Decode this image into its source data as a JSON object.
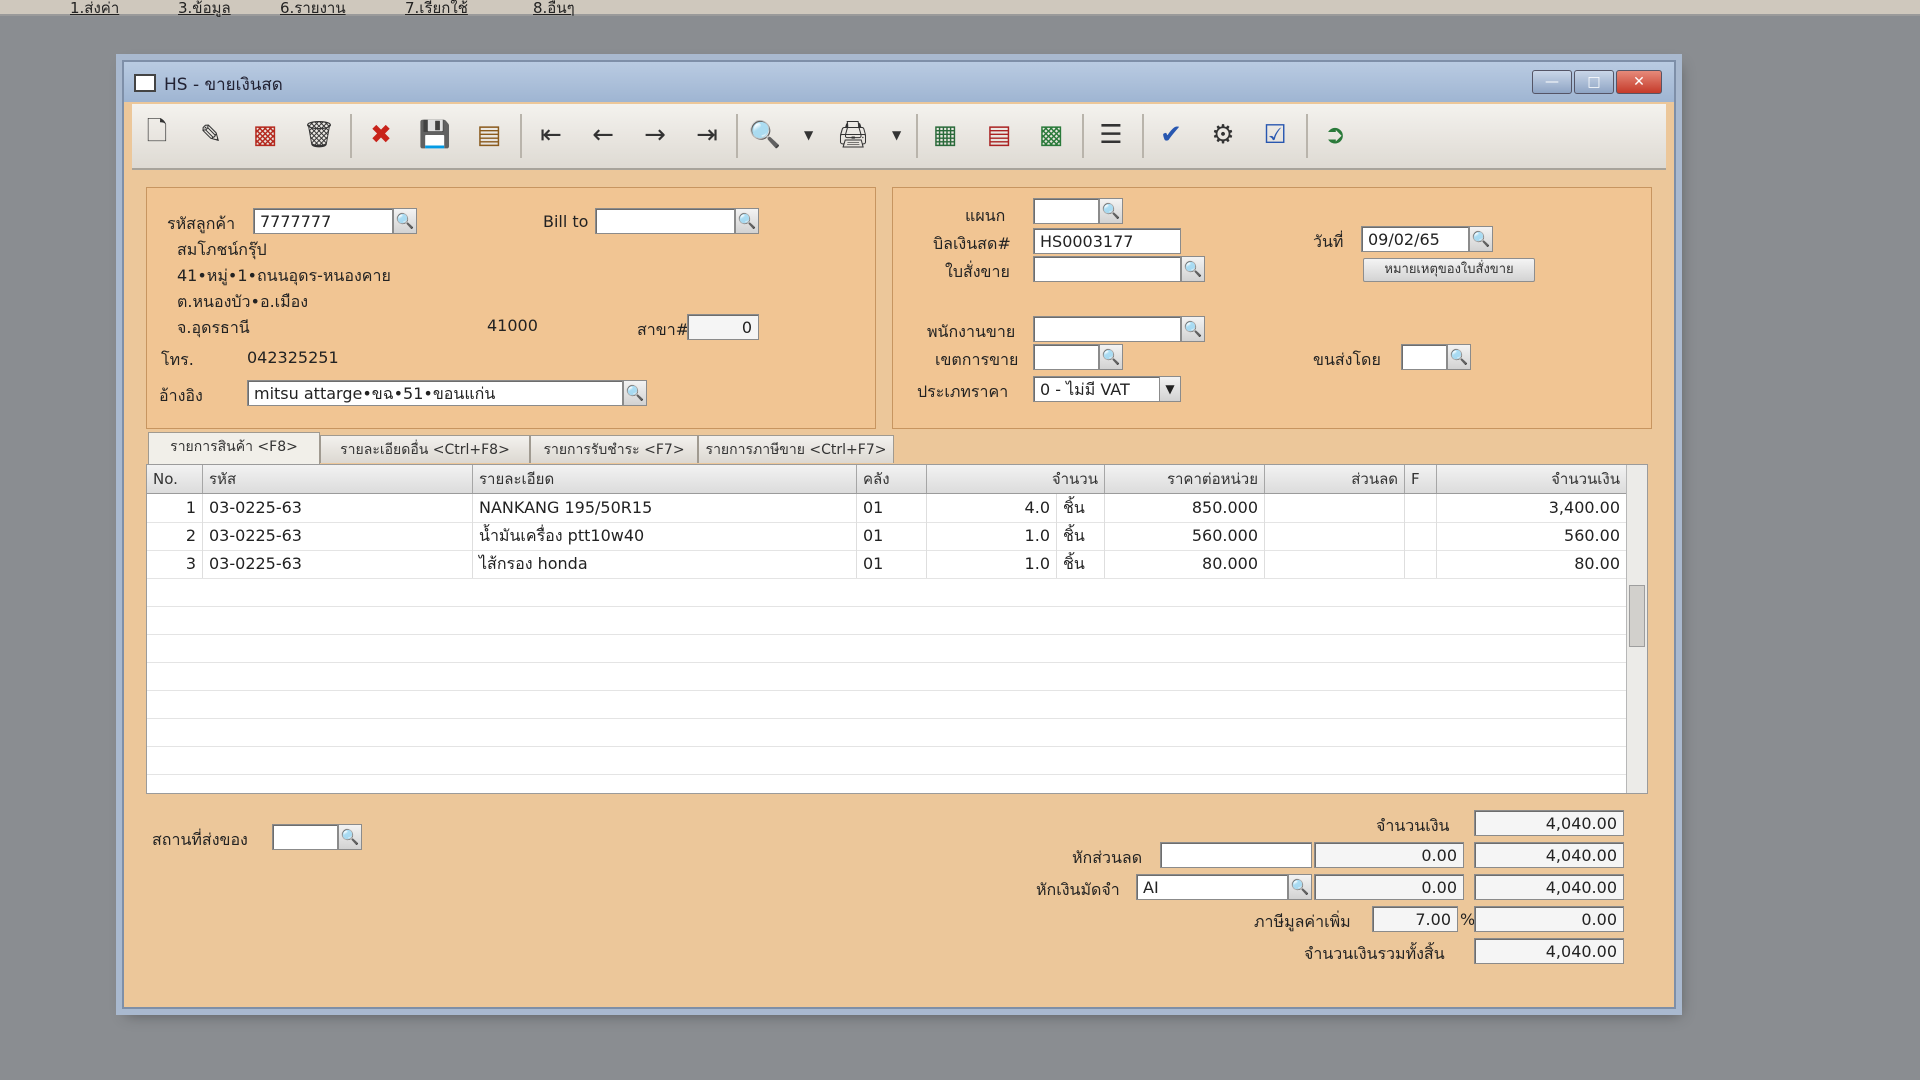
{
  "menubar": [
    "1.ส่งค่า",
    "3.ข้อมูล",
    "6.รายงาน",
    "7.เรียกใช้",
    "8.อื่นๆ"
  ],
  "window": {
    "title": "HS - ขายเงินสด"
  },
  "toolbar": {
    "icons": [
      "new-icon",
      "edit-icon",
      "void-icon",
      "delete-icon",
      "cancel-icon",
      "save-icon",
      "copy-icon",
      "first-icon",
      "prev-icon",
      "next-icon",
      "last-icon",
      "preview-icon",
      "print-icon",
      "calc-icon",
      "form-icon",
      "report-icon",
      "list-icon",
      "approve-icon",
      "check-icon",
      "ok-icon",
      "exit-icon"
    ]
  },
  "customer": {
    "code_label": "รหัสลูกค้า",
    "code": "7777777",
    "billto_label": "Bill to",
    "billto": "",
    "name": "สมโภชน์กรุ๊ป",
    "addr1": "41•หมู่•1•ถนนอุดร-หนองคาย",
    "addr2": "ต.หนองบัว•อ.เมือง",
    "addr3": "จ.อุดรธานี",
    "zip": "41000",
    "branch_label": "สาขา#",
    "branch": "0",
    "tel_label": "โทร.",
    "tel": "042325251",
    "ref_label": "อ้างอิง",
    "ref": "mitsu attarge•ขฉ•51•ขอนแก่น"
  },
  "doc": {
    "dept_label": "แผนก",
    "dept": "",
    "bill_label": "บิลเงินสด#",
    "bill": "HS0003177",
    "date_label": "วันที่",
    "date": "09/02/65",
    "order_label": "ใบสั่งขาย",
    "order": "",
    "note_button": "หมายเหตุของใบสั่งขาย",
    "sales_label": "พนักงานขาย",
    "sales": "",
    "area_label": "เขตการขาย",
    "area": "",
    "ship_label": "ขนส่งโดย",
    "ship": "",
    "price_label": "ประเภทราคา",
    "price_type": "0 - ไม่มี VAT"
  },
  "tabs": [
    "รายการสินค้า <F8>",
    "รายละเอียดอื่น <Ctrl+F8>",
    "รายการรับชำระ <F7>",
    "รายการภาษีขาย <Ctrl+F7>"
  ],
  "grid": {
    "headers": [
      "No.",
      "รหัส",
      "รายละเอียด",
      "คลัง",
      "จำนวน",
      "ราคาต่อหน่วย",
      "ส่วนลด",
      "F",
      "จำนวนเงิน"
    ],
    "rows": [
      {
        "no": "1",
        "code": "03-0225-63",
        "desc": "NANKANG 195/50R15",
        "wh": "01",
        "qty": "4.0",
        "unit": "ชิ้น",
        "price": "850.000",
        "disc": "",
        "f": "",
        "amount": "3,400.00"
      },
      {
        "no": "2",
        "code": "03-0225-63",
        "desc": "น้ำมันเครื่อง ptt10w40",
        "wh": "01",
        "qty": "1.0",
        "unit": "ชิ้น",
        "price": "560.000",
        "disc": "",
        "f": "",
        "amount": "560.00"
      },
      {
        "no": "3",
        "code": "03-0225-63",
        "desc": "ไส้กรอง honda",
        "wh": "01",
        "qty": "1.0",
        "unit": "ชิ้น",
        "price": "80.000",
        "disc": "",
        "f": "",
        "amount": "80.00"
      }
    ]
  },
  "footer": {
    "place_label": "สถานที่ส่งของ",
    "place": "",
    "amount_label": "จำนวนเงิน",
    "amount": "4,040.00",
    "discount_label": "หักส่วนลด",
    "discount_text": "",
    "discount_value": "0.00",
    "discount_total": "4,040.00",
    "deposit_label": "หักเงินมัดจำ",
    "deposit_code": "AI",
    "deposit_value": "0.00",
    "deposit_total": "4,040.00",
    "vat_label": "ภาษีมูลค่าเพิ่ม",
    "vat_rate": "7.00",
    "vat_pct": "%",
    "vat_value": "0.00",
    "grand_label": "จำนวนเงินรวมทั้งสิ้น",
    "grand_total": "4,040.00"
  }
}
